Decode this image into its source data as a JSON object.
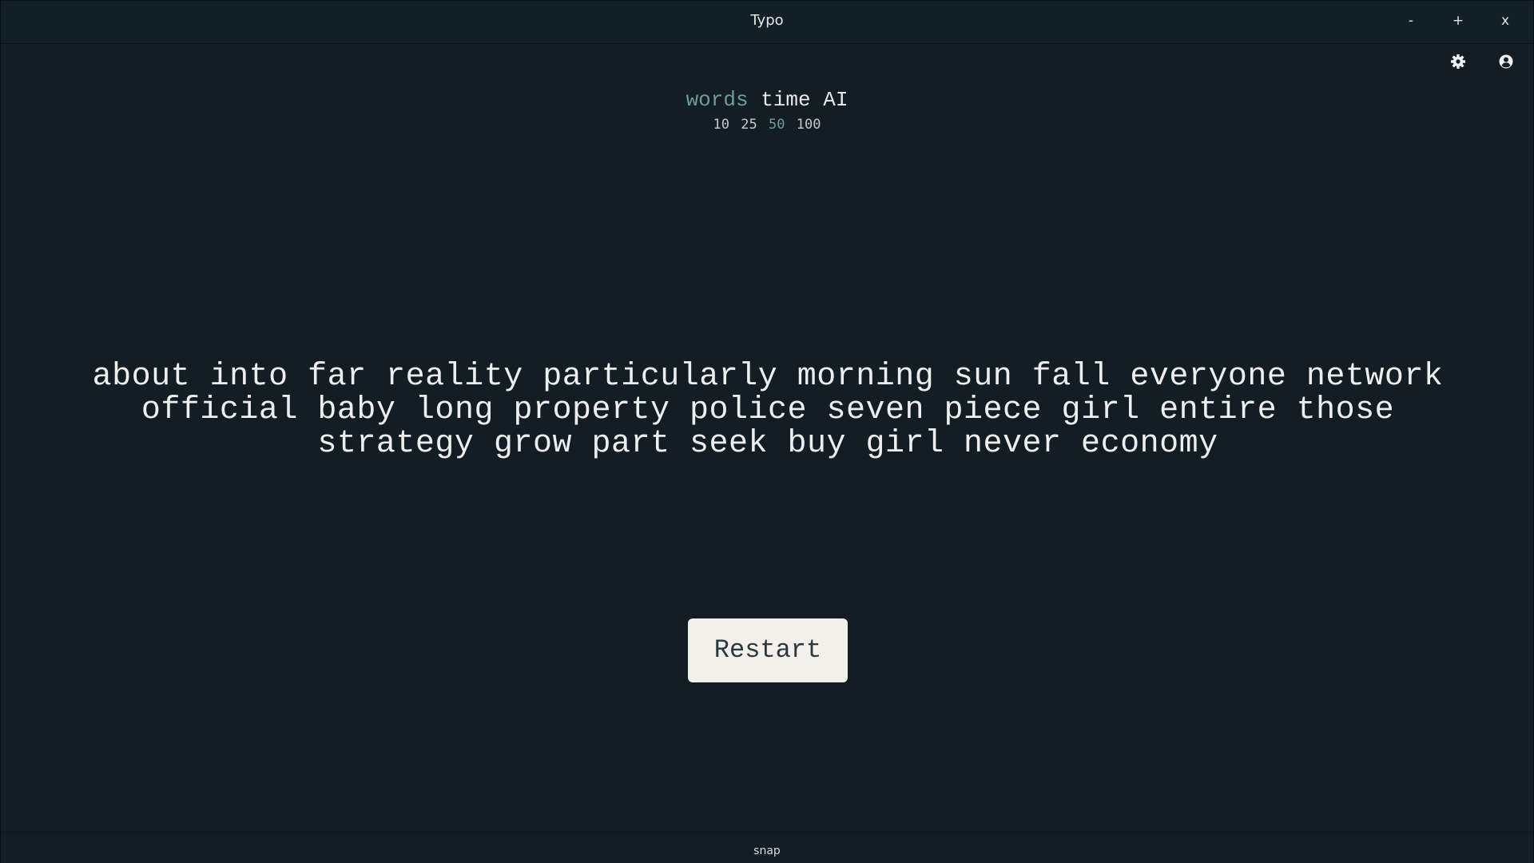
{
  "window": {
    "title": "Typo",
    "minimize_label": "-",
    "maximize_label": "+",
    "close_label": "x"
  },
  "toolbar": {
    "settings_icon": "gear-icon",
    "account_icon": "user-circle-icon"
  },
  "modes": {
    "options": [
      "words",
      "time",
      "AI"
    ],
    "selected": "words"
  },
  "word_counts": {
    "options": [
      "10",
      "25",
      "50",
      "100"
    ],
    "selected": "50"
  },
  "test": {
    "lines": [
      "about into far reality particularly morning sun fall everyone network",
      "official baby long property police seven piece girl entire those",
      "strategy grow part seek buy girl never economy"
    ]
  },
  "restart_label": "Restart",
  "footer": {
    "label": "snap"
  },
  "colors": {
    "background": "#131d24",
    "accent": "#6f9c97",
    "text": "#eeeeee",
    "button_bg": "#f3efea"
  }
}
